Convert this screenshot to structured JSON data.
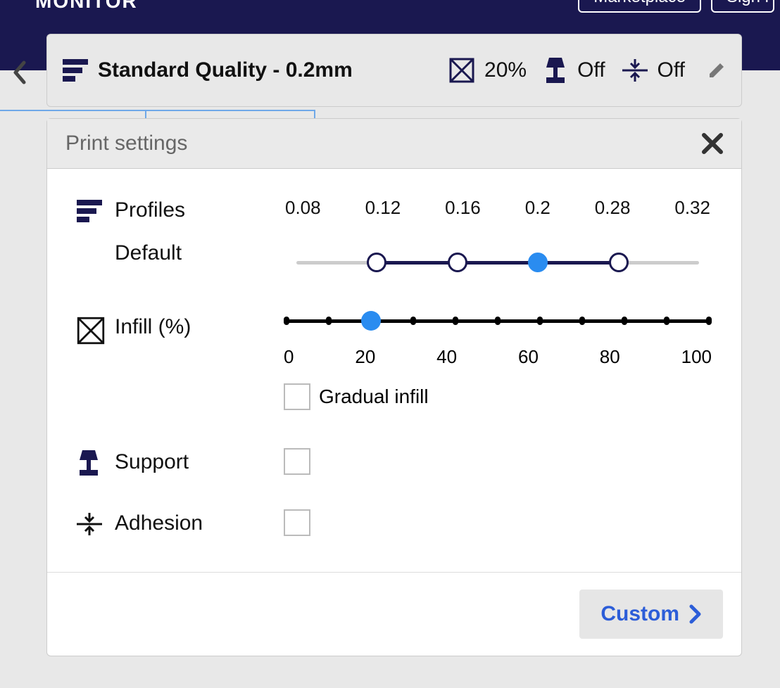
{
  "topnav": {
    "title_fragment": "MONITOR",
    "marketplace_label": "Marketplace",
    "signin_label": "Sign i"
  },
  "summary": {
    "quality_label": "Standard Quality - 0.2mm",
    "infill_label": "20%",
    "support_label": "Off",
    "adhesion_label": "Off"
  },
  "panel": {
    "title": "Print settings",
    "profiles": {
      "label": "Profiles",
      "sublabel": "Default",
      "ticks": [
        "0.08",
        "0.12",
        "0.16",
        "0.2",
        "0.28",
        "0.32"
      ],
      "available_positions": [
        1,
        2,
        3,
        4
      ],
      "selected_index": 3
    },
    "infill": {
      "label": "Infill (%)",
      "ticks": [
        "0",
        "20",
        "40",
        "60",
        "80",
        "100"
      ],
      "minor_per_major": 2,
      "value": 20,
      "gradual_label": "Gradual infill",
      "gradual_checked": false
    },
    "support": {
      "label": "Support",
      "checked": false
    },
    "adhesion": {
      "label": "Adhesion",
      "checked": false
    },
    "custom_label": "Custom"
  },
  "icons": {
    "layers": "layers",
    "infill": "infill",
    "support": "support",
    "adhesion": "adhesion"
  }
}
